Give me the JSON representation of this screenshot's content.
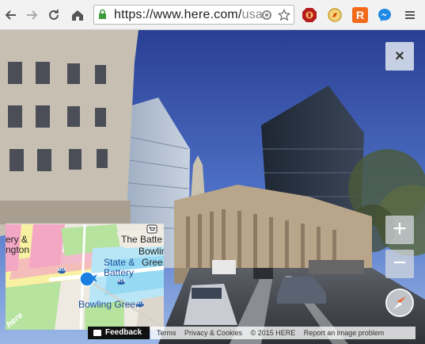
{
  "browser": {
    "url_host": "https://www.here.com/",
    "url_rest": "usa",
    "nav_icons": [
      "back-arrow-icon",
      "forward-arrow-icon",
      "reload-icon",
      "home-icon"
    ],
    "extensions": [
      "ublock-icon",
      "compass-extension-icon",
      "r-extension-icon",
      "messenger-icon",
      "menu-icon"
    ]
  },
  "viewer": {
    "close_label": "×",
    "zoom_in_label": "+",
    "zoom_out_label": "−"
  },
  "minimap": {
    "labels": [
      "ery &",
      "ngton",
      "The Batte",
      "Bowlin",
      "Gree",
      "State &",
      "Battery",
      "Bowling Green"
    ],
    "metro_badge": "MTA"
  },
  "footer": {
    "feedback_label": "Feedback",
    "terms": "Terms",
    "privacy": "Privacy & Cookies",
    "copyright": "© 2015 HERE",
    "report": "Report an image problem",
    "logo": "here"
  },
  "colors": {
    "accent_blue": "#1a7fe0",
    "map_pink": "#f4a7c3",
    "map_green": "#b6e39e",
    "map_yellow": "#f7f1a1"
  }
}
